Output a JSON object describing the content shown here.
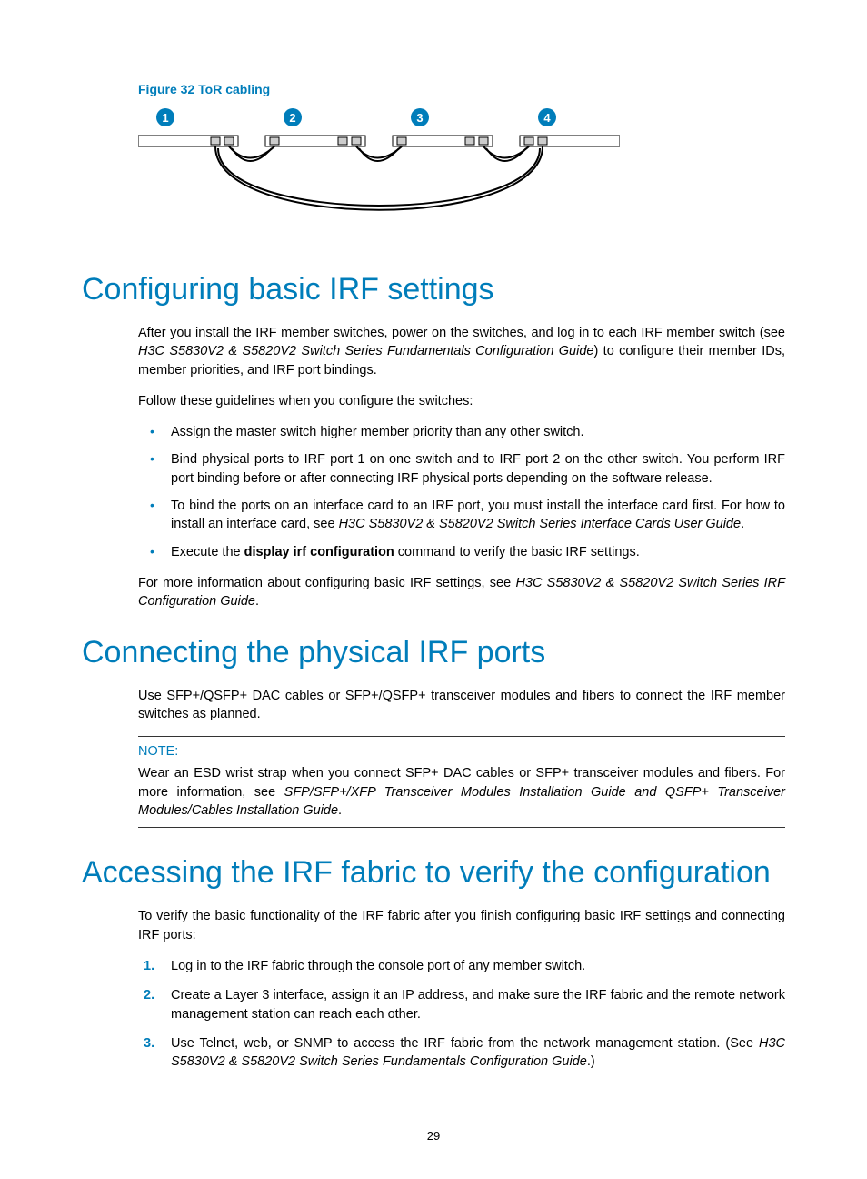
{
  "figure": {
    "caption": "Figure 32 ToR cabling",
    "badge_count": 4
  },
  "sections": [
    {
      "heading": "Configuring basic IRF settings",
      "para_intro_pre": "After you install the IRF member switches, power on the switches, and log in to each IRF member switch (see ",
      "para_intro_italic": "H3C S5830V2 & S5820V2 Switch Series Fundamentals Configuration Guide",
      "para_intro_post": ") to configure their member IDs, member priorities, and IRF port bindings.",
      "para_follow": "Follow these guidelines when you configure the switches:",
      "bullets": [
        {
          "pre": "Assign the master switch higher member priority than any other switch.",
          "italic": "",
          "post": ""
        },
        {
          "pre": "Bind physical ports to IRF port 1 on one switch and to IRF port 2 on the other switch. You perform IRF port binding before or after connecting IRF physical ports depending on the software release.",
          "italic": "",
          "post": ""
        },
        {
          "pre": "To bind the ports on an interface card to an IRF port, you must install the interface card first. For how to install an interface card, see ",
          "italic": "H3C S5830V2 & S5820V2 Switch Series Interface Cards User Guide",
          "post": "."
        },
        {
          "pre": "Execute the ",
          "bold": "display irf configuration",
          "post": " command to verify the basic IRF settings."
        }
      ],
      "para_more_pre": "For more information about configuring basic IRF settings, see ",
      "para_more_italic": "H3C S5830V2 & S5820V2 Switch Series IRF Configuration Guide",
      "para_more_post": "."
    },
    {
      "heading": "Connecting the physical IRF ports",
      "para_use": "Use SFP+/QSFP+ DAC cables or SFP+/QSFP+ transceiver modules and fibers to connect the IRF member switches as planned.",
      "note_label": "NOTE:",
      "note_pre": "Wear an ESD wrist strap when you connect SFP+ DAC cables or SFP+ transceiver modules and fibers. For more information, see ",
      "note_italic": "SFP/SFP+/XFP Transceiver Modules Installation Guide and QSFP+ Transceiver Modules/Cables Installation Guide",
      "note_post": "."
    },
    {
      "heading": "Accessing the IRF fabric to verify the configuration",
      "para_verify": "To verify the basic functionality of the IRF fabric after you finish configuring basic IRF settings and connecting IRF ports:",
      "steps": [
        {
          "text": "Log in to the IRF fabric through the console port of any member switch.",
          "italic": "",
          "post": ""
        },
        {
          "text": "Create a Layer 3 interface, assign it an IP address, and make sure the IRF fabric and the remote network management station can reach each other.",
          "italic": "",
          "post": ""
        },
        {
          "text": "Use Telnet, web, or SNMP to access the IRF fabric from the network management station. (See ",
          "italic": "H3C S5830V2 & S5820V2 Switch Series Fundamentals Configuration Guide",
          "post": ".)"
        }
      ]
    }
  ],
  "page_number": "29"
}
